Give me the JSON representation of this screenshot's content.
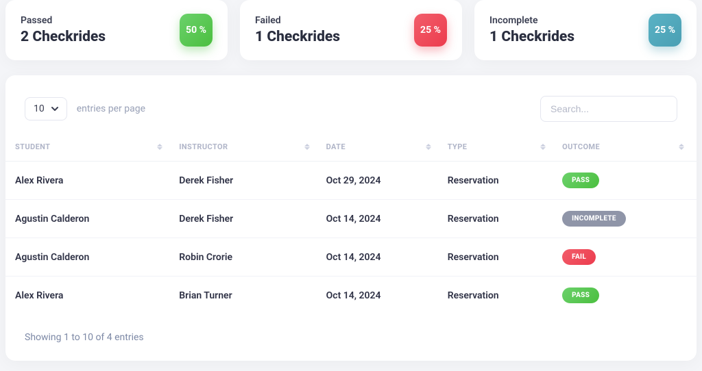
{
  "stats": [
    {
      "label": "Passed",
      "value": "2 Checkrides",
      "percent": "50 %",
      "badgeClass": "badge-green"
    },
    {
      "label": "Failed",
      "value": "1 Checkrides",
      "percent": "25 %",
      "badgeClass": "badge-red"
    },
    {
      "label": "Incomplete",
      "value": "1 Checkrides",
      "percent": "25 %",
      "badgeClass": "badge-teal"
    }
  ],
  "controls": {
    "page_size": "10",
    "entries_label": "entries per page",
    "search_placeholder": "Search..."
  },
  "columns": {
    "student": "Student",
    "instructor": "Instructor",
    "date": "Date",
    "type": "Type",
    "outcome": "Outcome"
  },
  "rows": [
    {
      "student": "Alex Rivera",
      "instructor": "Derek Fisher",
      "date": "Oct 29, 2024",
      "type": "Reservation",
      "outcome": "Pass",
      "pillClass": "pill-pass"
    },
    {
      "student": "Agustin Calderon",
      "instructor": "Derek Fisher",
      "date": "Oct 14, 2024",
      "type": "Reservation",
      "outcome": "Incomplete",
      "pillClass": "pill-incomplete"
    },
    {
      "student": "Agustin Calderon",
      "instructor": "Robin Crorie",
      "date": "Oct 14, 2024",
      "type": "Reservation",
      "outcome": "Fail",
      "pillClass": "pill-fail"
    },
    {
      "student": "Alex Rivera",
      "instructor": "Brian Turner",
      "date": "Oct 14, 2024",
      "type": "Reservation",
      "outcome": "Pass",
      "pillClass": "pill-pass"
    }
  ],
  "footer": "Showing 1 to 10 of 4 entries"
}
